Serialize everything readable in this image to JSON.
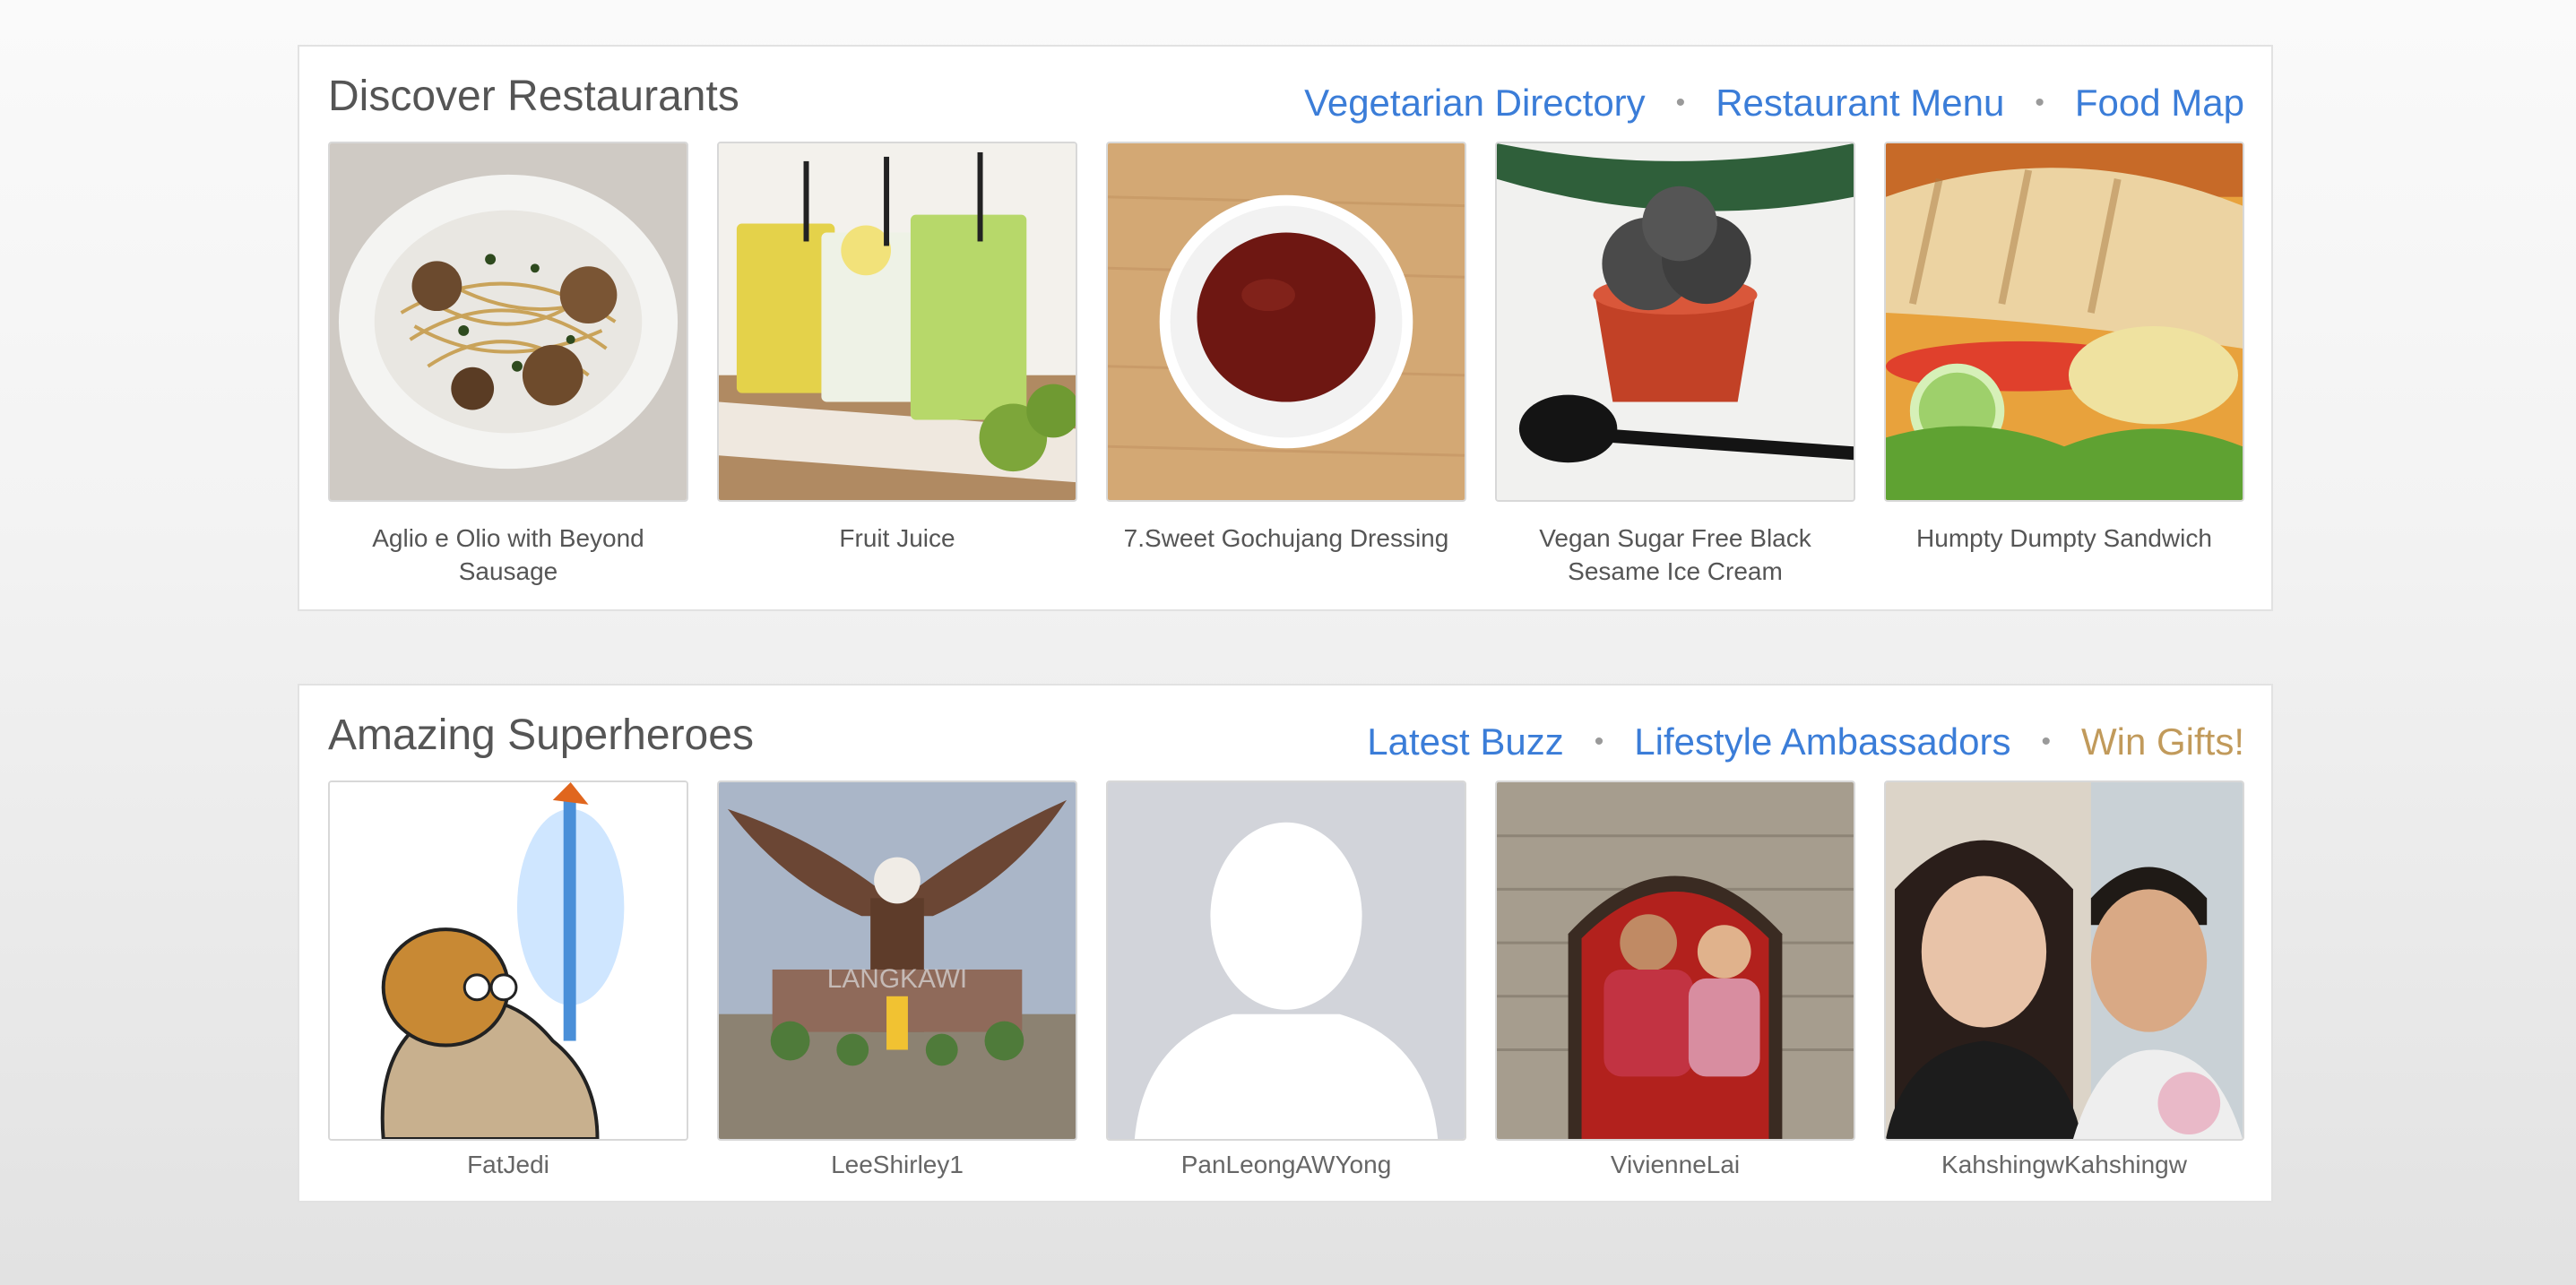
{
  "restaurants": {
    "title": "Discover Restaurants",
    "links": [
      "Vegetarian Directory",
      "Restaurant Menu",
      "Food Map"
    ],
    "separator": "•",
    "items": [
      {
        "caption": "Aglio e Olio with Beyond Sausage",
        "image": "pasta-dish-photo"
      },
      {
        "caption": "Fruit Juice",
        "image": "juice-glasses-photo"
      },
      {
        "caption": "7.Sweet Gochujang Dressing",
        "image": "sauce-bowl-photo"
      },
      {
        "caption": "Vegan Sugar Free Black Sesame Ice Cream",
        "image": "ice-cream-photo"
      },
      {
        "caption": "Humpty Dumpty Sandwich",
        "image": "sandwich-photo"
      }
    ]
  },
  "superheroes": {
    "title": "Amazing Superheroes",
    "links": [
      "Latest Buzz",
      "Lifestyle Ambassadors",
      "Win Gifts!"
    ],
    "separator": "•",
    "items": [
      {
        "name": "FatJedi",
        "image": "cartoon-avatar"
      },
      {
        "name": "LeeShirley1",
        "image": "eagle-statue-photo",
        "photo_text": "LANGKAWI"
      },
      {
        "name": "PanLeongAWYong",
        "image": "default-avatar"
      },
      {
        "name": "VivienneLai",
        "image": "couple-window-photo"
      },
      {
        "name": "KahshingwKahshingw",
        "image": "couple-selfie-photo"
      }
    ]
  },
  "colors": {
    "link": "#3b7dd8",
    "link_gold": "#c19a5b",
    "title_text": "#555555",
    "panel_border": "#e2e2e2"
  }
}
